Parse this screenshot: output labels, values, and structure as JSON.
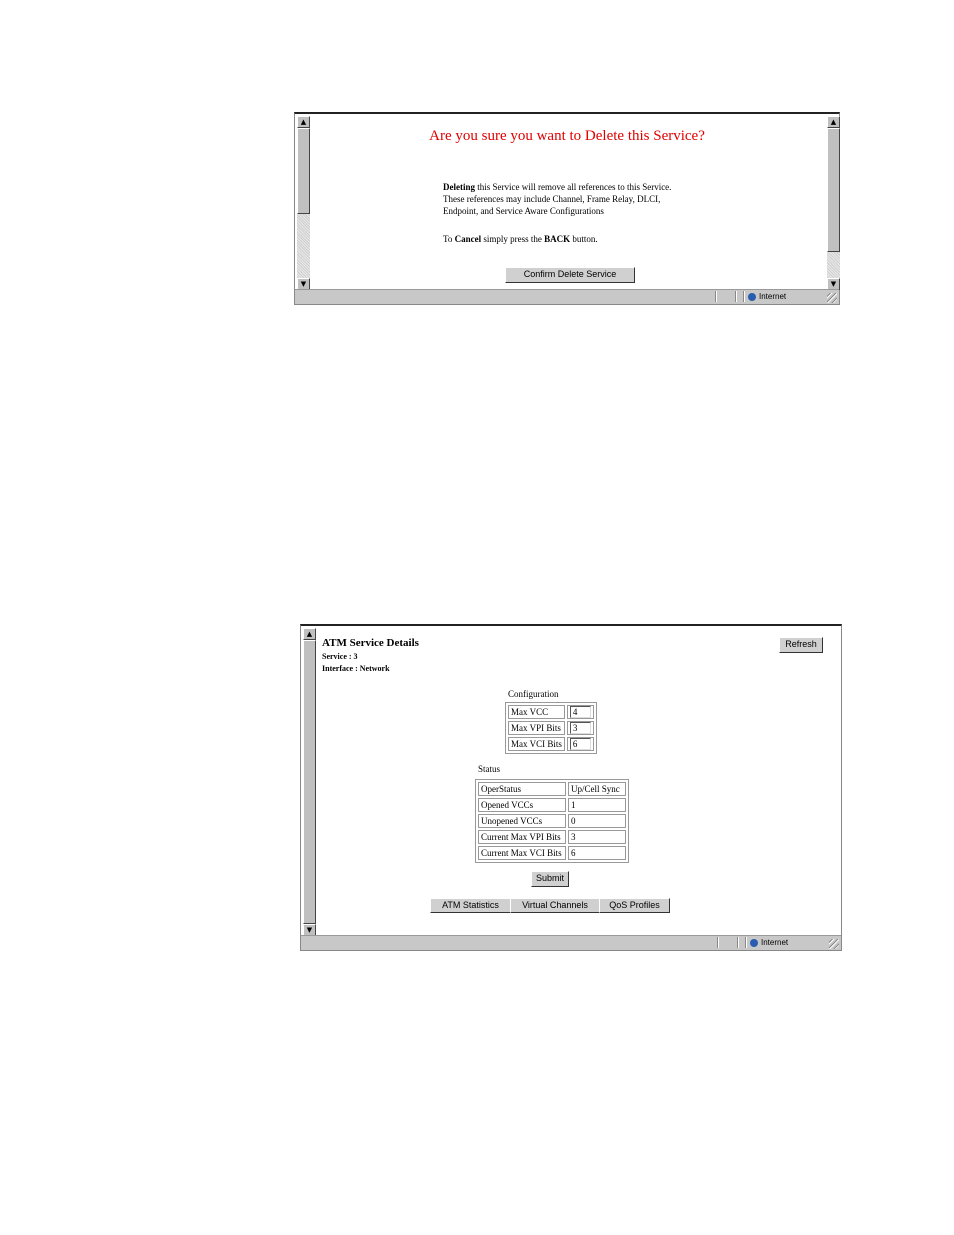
{
  "delete_window": {
    "title": "Are you sure you want to Delete this Service?",
    "para1_bold": "Deleting",
    "para1_rest": " this Service will remove all references to this Service.",
    "para1_line2": "These references may include Channel, Frame Relay, DLCI,",
    "para1_line3": "Endpoint, and  Service Aware Configurations",
    "para2_pre": "To ",
    "para2_bold1": "Cancel",
    "para2_mid": " simply press the ",
    "para2_bold2": "BACK",
    "para2_post": " button.",
    "confirm_button": "Confirm Delete Service",
    "status_zone": "Internet"
  },
  "details_window": {
    "title": "ATM Service Details",
    "service_line": "Service : 3",
    "interface_line": "Interface : Network",
    "refresh_button": "Refresh",
    "configuration_label": "Configuration",
    "configuration": [
      {
        "label": "Max VCC",
        "value": "4"
      },
      {
        "label": "Max VPI Bits",
        "value": "3"
      },
      {
        "label": "Max VCI Bits",
        "value": "6"
      }
    ],
    "status_label": "Status",
    "status": [
      {
        "label": "OperStatus",
        "value": "Up/Cell Sync"
      },
      {
        "label": "Opened VCCs",
        "value": "1"
      },
      {
        "label": "Unopened VCCs",
        "value": "0"
      },
      {
        "label": "Current Max VPI Bits",
        "value": "3"
      },
      {
        "label": "Current Max VCI Bits",
        "value": "6"
      }
    ],
    "submit_button": "Submit",
    "tabs": [
      "ATM Statistics",
      "Virtual Channels",
      "QoS Profiles"
    ],
    "status_zone": "Internet"
  },
  "icons": {
    "scroll_up": "▲",
    "scroll_down": "▼"
  }
}
